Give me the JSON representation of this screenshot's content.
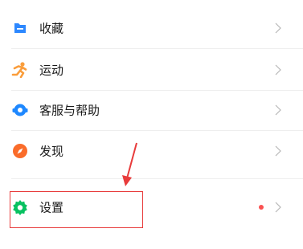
{
  "menu": {
    "items": [
      {
        "label": "收藏",
        "icon": "favorites-icon",
        "color": "#2d88ff"
      },
      {
        "label": "运动",
        "icon": "running-icon",
        "color": "#fa9d3b"
      },
      {
        "label": "客服与帮助",
        "icon": "customer-service-icon",
        "color": "#1e88ff"
      },
      {
        "label": "发现",
        "icon": "compass-icon",
        "color": "#fa6c2a"
      }
    ],
    "settings": {
      "label": "设置",
      "icon": "gear-icon",
      "color": "#07c160",
      "badge_color": "#fa5151"
    }
  },
  "annotation": {
    "color": "#e83b3b"
  }
}
